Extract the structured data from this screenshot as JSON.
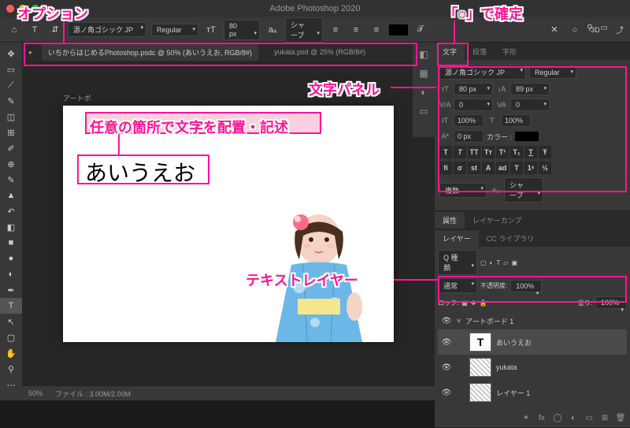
{
  "annotations": {
    "options": "オプション",
    "confirm": "「○」で確定",
    "char_panel": "文字パネル",
    "place_text": "任意の箇所で文字を配置・記述",
    "text_layer": "テキストレイヤー"
  },
  "app_title": "Adobe Photoshop 2020",
  "options_bar": {
    "font_family": "源ノ角ゴシック JP",
    "font_style": "Regular",
    "font_size": "80 px",
    "aa": "シャープ"
  },
  "confirm": {
    "cancel": "✕",
    "ok": "○",
    "threed": "3D"
  },
  "tabs": {
    "active": "いちからはじめるPhotoshop.psdc @ 50% (あいうえお, RGB/8#)",
    "other": "yukata.psd @ 25% (RGB/8#)"
  },
  "artboard": {
    "label": "アートボ",
    "text": "あいうえお"
  },
  "char_panel": {
    "tab1": "文字",
    "tab2": "段落",
    "tab3": "字形",
    "font_family": "源ノ角ゴシック JP",
    "font_style": "Regular",
    "size": "80 px",
    "leading": "89 px",
    "va": "0",
    "kerning": "0",
    "scale_v": "100%",
    "scale_h": "100%",
    "baseline": "0 px",
    "color_label": "カラー :",
    "lang": "複数",
    "aa": "シャープ"
  },
  "props": {
    "tab1": "属性",
    "tab2": "レイヤーカンプ"
  },
  "layers": {
    "tab1": "レイヤー",
    "tab2": "CC ライブラリ",
    "blend": "通常",
    "opacity_label": "不透明度:",
    "opacity": "100%",
    "lock_label": "ロック:",
    "fill_label": "塗り:",
    "fill": "100%",
    "filter": "Q 種類",
    "artboard": "アートボード 1",
    "items": [
      {
        "name": "あいうえお",
        "type": "text",
        "selected": true
      },
      {
        "name": "yukata",
        "type": "img",
        "selected": false
      },
      {
        "name": "レイヤー 1",
        "type": "img",
        "selected": false
      }
    ]
  },
  "status": {
    "zoom": "50%",
    "file": "ファイル : 3.00M/2.00M"
  }
}
